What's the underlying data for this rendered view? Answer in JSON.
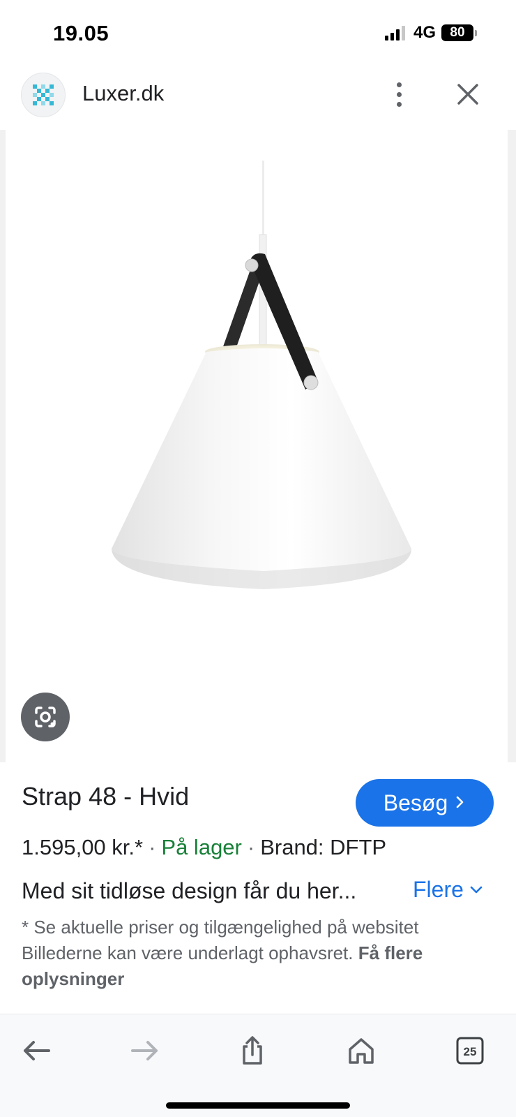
{
  "status_bar": {
    "time": "19.05",
    "network": "4G",
    "battery": "80"
  },
  "top_bar": {
    "site_name": "Luxer.dk",
    "icons": [
      "luxer-logo-icon",
      "more-vert-icon",
      "close-icon"
    ]
  },
  "image_area": {
    "lens_icon": "google-lens-icon"
  },
  "product": {
    "title": "Strap 48 - Hvid",
    "visit_label": "Besøg",
    "price": "1.595,00 kr.*",
    "stock": "På lager",
    "brand": "Brand: DFTP",
    "description": "Med sit tidløse design får du her...",
    "more_label": "Flere",
    "disclaimer_text": "* Se aktuelle priser og tilgængelighed på websitet Billederne kan være underlagt ophavsret.",
    "disclaimer_link": "Få flere oplysninger"
  },
  "toolbar": {
    "tab_count": "25",
    "icons": [
      "back-arrow-icon",
      "forward-arrow-icon",
      "share-icon",
      "home-icon",
      "tabs-icon"
    ]
  },
  "colors": {
    "accent": "#1a73e8",
    "in_stock": "#188038",
    "secondary_text": "#5f6368"
  }
}
